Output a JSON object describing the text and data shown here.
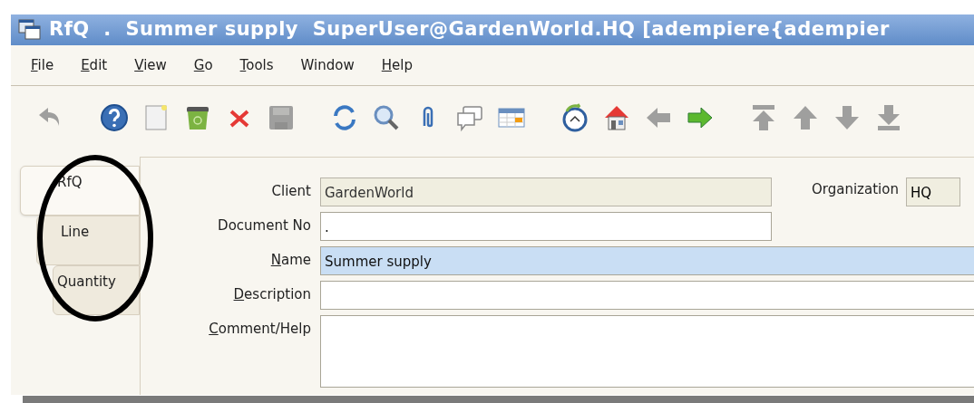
{
  "window": {
    "title": "RfQ  .  Summer supply  SuperUser@GardenWorld.HQ [adempiere{adempier"
  },
  "menu": [
    {
      "label": "File",
      "underlined_first": true
    },
    {
      "label": "Edit",
      "underlined_first": true
    },
    {
      "label": "View",
      "underlined_first": true
    },
    {
      "label": "Go",
      "underlined_first": true
    },
    {
      "label": "Tools",
      "underlined_first": true
    },
    {
      "label": "Window",
      "underlined_first": false
    },
    {
      "label": "Help",
      "underlined_first": true
    }
  ],
  "toolbar": [
    {
      "kind": "undo",
      "disabled": true
    },
    {
      "kind": "gap"
    },
    {
      "kind": "help",
      "disabled": false
    },
    {
      "kind": "new",
      "disabled": false
    },
    {
      "kind": "trash",
      "disabled": false
    },
    {
      "kind": "delete",
      "disabled": false
    },
    {
      "kind": "save",
      "disabled": true
    },
    {
      "kind": "gap"
    },
    {
      "kind": "refresh",
      "disabled": false
    },
    {
      "kind": "find",
      "disabled": false
    },
    {
      "kind": "attach",
      "disabled": false
    },
    {
      "kind": "chat",
      "disabled": false
    },
    {
      "kind": "grid",
      "disabled": false
    },
    {
      "kind": "gap"
    },
    {
      "kind": "history",
      "disabled": false
    },
    {
      "kind": "home",
      "disabled": false
    },
    {
      "kind": "back",
      "disabled": true
    },
    {
      "kind": "forward",
      "disabled": false
    },
    {
      "kind": "gap"
    },
    {
      "kind": "first",
      "disabled": true
    },
    {
      "kind": "up",
      "disabled": true
    },
    {
      "kind": "down",
      "disabled": true
    },
    {
      "kind": "last",
      "disabled": true
    }
  ],
  "tabs": [
    {
      "label": "RfQ",
      "selected": true
    },
    {
      "label": "Line",
      "selected": false
    },
    {
      "label": "Quantity",
      "selected": false
    }
  ],
  "annotation": {
    "kind": "ellipse"
  },
  "fields": [
    {
      "label": "Client",
      "underlined_first": false,
      "value": "GardenWorld",
      "readonly": true,
      "focused": false,
      "kind": "medium"
    },
    {
      "label": "Document No",
      "underlined_first": false,
      "value": ".",
      "readonly": false,
      "focused": false,
      "kind": "medium"
    },
    {
      "label": "Name",
      "underlined_first": true,
      "value": "Summer supply",
      "readonly": false,
      "focused": true,
      "kind": "wide"
    },
    {
      "label": "Description",
      "underlined_first": true,
      "readonly": false,
      "focused": false,
      "kind": "wide"
    },
    {
      "label": "Comment/Help",
      "underlined_first": true,
      "readonly": false,
      "focused": false,
      "kind": "area"
    }
  ],
  "side_field": {
    "label": "Organization",
    "underlined_first": false,
    "value": "HQ",
    "readonly": true
  }
}
